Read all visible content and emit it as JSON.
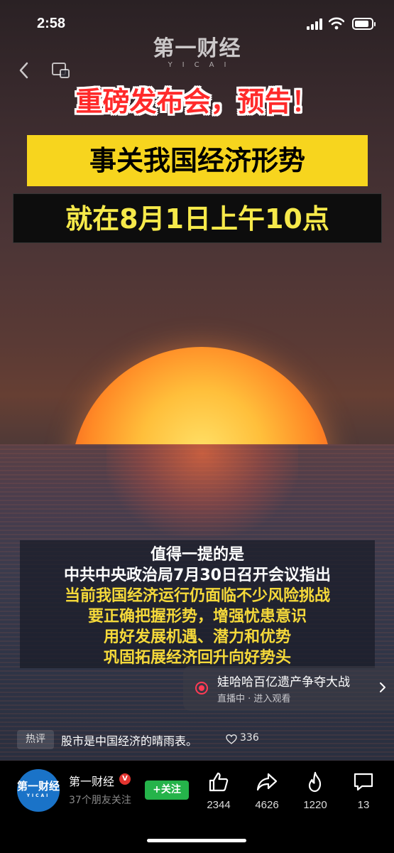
{
  "status_bar": {
    "time": "2:58"
  },
  "logo": {
    "cn": "第一财经",
    "en": "YICAI"
  },
  "video": {
    "headline1": "重磅发布会，预告！",
    "headline2": "事关我国经济形势",
    "headline3": "就在8月1日上午10点",
    "caption_lines": [
      {
        "text": "值得一提的是",
        "color": "#ffffff"
      },
      {
        "text": "中共中央政治局7月30日召开会议指出",
        "color": "#ffffff"
      },
      {
        "text": "当前我国经济运行仍面临不少风险挑战",
        "color": "#f5d93a"
      },
      {
        "text": "要正确把握形势，增强忧患意识",
        "color": "#f5d93a"
      },
      {
        "text": "用好发展机遇、潜力和优势",
        "color": "#f5d93a"
      },
      {
        "text": "巩固拓展经济回升向好势头",
        "color": "#f5d93a"
      }
    ]
  },
  "live_card": {
    "title": "娃哈哈百亿遗产争夺大战",
    "subtitle": "直播中 · 进入观看"
  },
  "comment": {
    "tag": "热评",
    "text": "股市是中国经济的晴雨表。",
    "likes": "336"
  },
  "account": {
    "avatar_text": "第一财经",
    "avatar_sub": "YICAI",
    "name": "第一财经",
    "badge": "V",
    "friends": "37个朋友关注",
    "follow_label": "+关注"
  },
  "actions": [
    {
      "icon": "thumbs-up-icon",
      "count": "2344"
    },
    {
      "icon": "share-icon",
      "count": "4626"
    },
    {
      "icon": "flame-icon",
      "count": "1220"
    },
    {
      "icon": "comment-icon",
      "count": "13"
    }
  ]
}
